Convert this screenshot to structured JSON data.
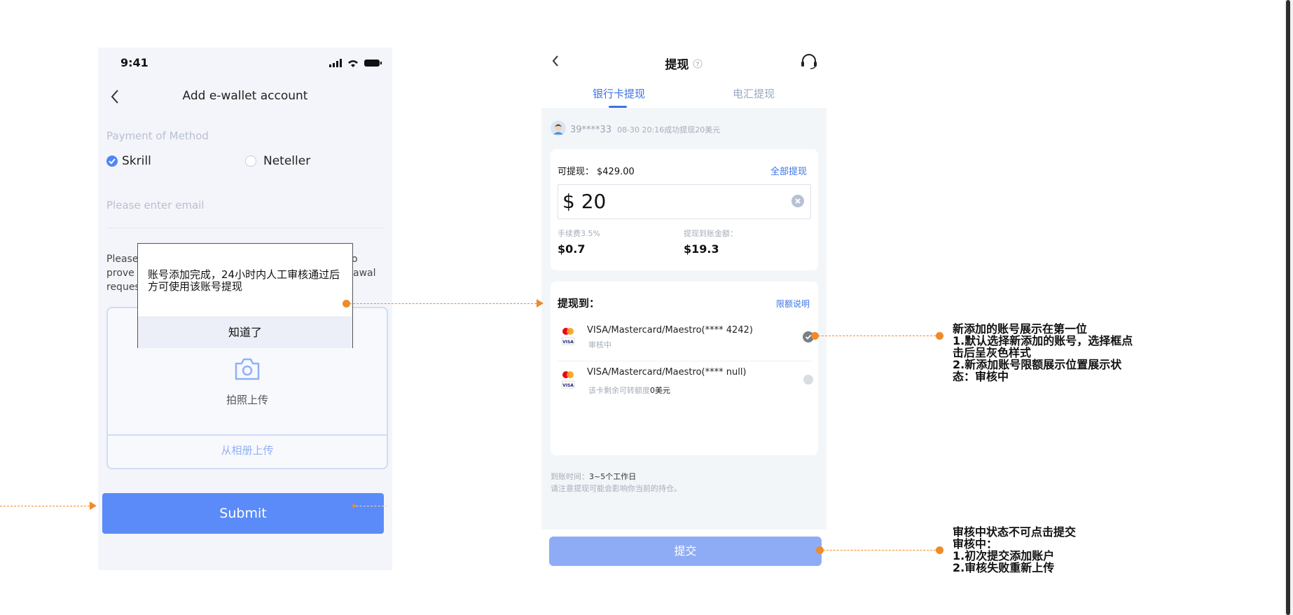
{
  "phone1": {
    "status_time": "9:41",
    "title": "Add e-wallet account",
    "method_label": "Payment of Method",
    "option_skrill": "Skrill",
    "option_neteller": "Neteller",
    "email_placeholder": "Please enter email",
    "note_lines": [
      "Please",
      "prove t",
      "reques"
    ],
    "note_tail": [
      "o",
      "awal"
    ],
    "upload_label": "拍照上传",
    "album_label": "从相册上传",
    "submit_label": "Submit",
    "dialog": {
      "message": "账号添加完成，24小时内人工审核通过后方可使用该账号提现",
      "ok_label": "知道了"
    }
  },
  "phone2": {
    "title": "提现",
    "tabs": [
      {
        "label": "银行卡提现",
        "active": true
      },
      {
        "label": "电汇提现",
        "active": false
      }
    ],
    "notice": {
      "user": "39****33",
      "text": "08-30 20:16成功提现20美元"
    },
    "available_label": "可提现：",
    "available_value": "$429.00",
    "withdraw_all": "全部提现",
    "amount": "$ 20",
    "fee_label": "手续费3.5%",
    "fee_value": "$0.7",
    "received_label": "提现到账金额：",
    "received_value": "$19.3",
    "to_label": "提现到：",
    "limit_link": "限额说明",
    "cards": [
      {
        "name": "VISA/Mastercard/Maestro(**** 4242)",
        "sub": "审核中",
        "sub_strong": "",
        "sub_tail": "",
        "selected": true
      },
      {
        "name": "VISA/Mastercard/Maestro(**** null)",
        "sub": "该卡剩余可转额度",
        "sub_strong": "0美元",
        "sub_tail": "",
        "selected": false
      }
    ],
    "arrival_label": "到账时间：",
    "arrival_value": "3~5个工作日",
    "warning": "请注意提现可能会影响你当前的持仓。",
    "submit_label": "提交"
  },
  "annotations": {
    "first": [
      "新添加的账号展示在第一位",
      "1.默认选择新添加的账号，选择框点",
      "击后呈灰色样式",
      "2.新添加账号限额展示位置展示状",
      "态：审核中"
    ],
    "second": [
      "审核中状态不可点击提交",
      "审核中：",
      "1.初次提交添加账户",
      "2.审核失败重新上传"
    ]
  },
  "colors": {
    "accent": "#4f86f7",
    "submit_blue": "#5b8bf8",
    "submit_disabled": "#8eacf6",
    "annotation_orange": "#f08a2a"
  }
}
